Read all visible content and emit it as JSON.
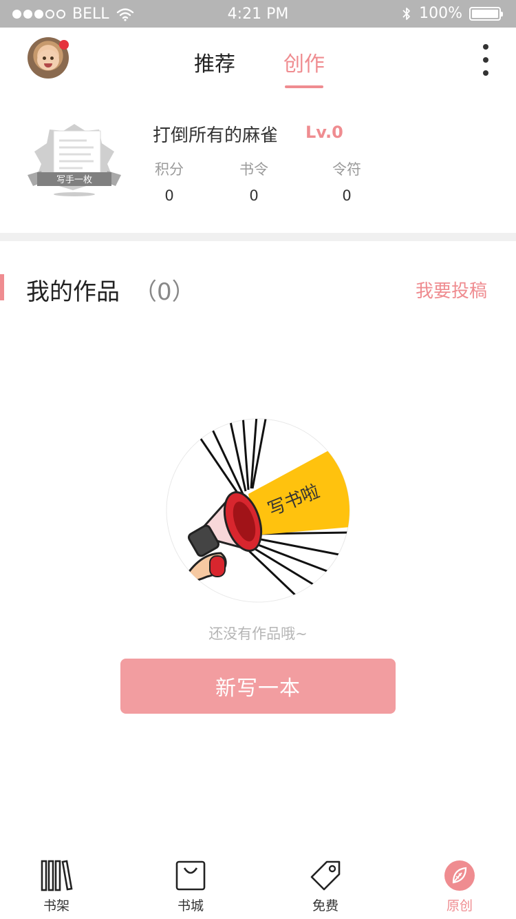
{
  "status_bar": {
    "carrier": "BELL",
    "time": "4:21 PM",
    "battery": "100%"
  },
  "header": {
    "tabs": [
      {
        "label": "推荐",
        "active": false
      },
      {
        "label": "创作",
        "active": true
      }
    ],
    "more_icon": "more-vertical-icon"
  },
  "profile": {
    "badge_label": "写手一枚",
    "username": "打倒所有的麻雀",
    "level": "Lv.0",
    "stats": [
      {
        "label": "积分",
        "value": "0"
      },
      {
        "label": "书令",
        "value": "0"
      },
      {
        "label": "令符",
        "value": "0"
      }
    ]
  },
  "works": {
    "title": "我的作品",
    "count": "（0）",
    "submit_label": "我要投稿",
    "illustration_text": "写书啦",
    "empty_text": "还没有作品哦~",
    "new_button_label": "新写一本"
  },
  "bottom_nav": {
    "items": [
      {
        "label": "书架",
        "icon": "bookshelf-icon",
        "active": false
      },
      {
        "label": "书城",
        "icon": "shopping-bag-icon",
        "active": false
      },
      {
        "label": "免费",
        "icon": "tag-icon",
        "active": false
      },
      {
        "label": "原创",
        "icon": "leaf-icon",
        "active": true
      }
    ]
  },
  "colors": {
    "accent": "#ef8c90",
    "button": "#f29da0",
    "status_bar": "#b5b5b5",
    "notify": "#e5323c",
    "megaphone_beam": "#ffc20e"
  }
}
